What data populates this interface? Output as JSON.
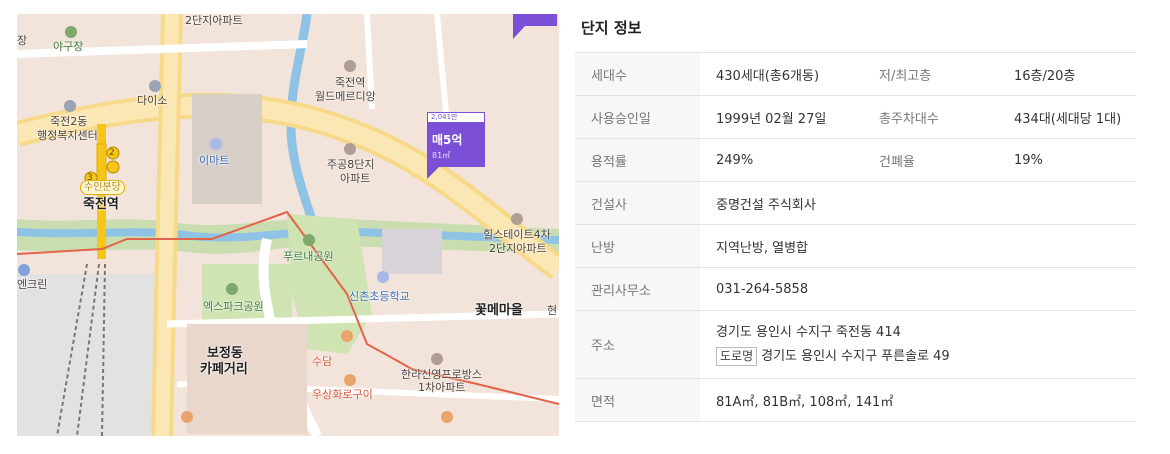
{
  "map": {
    "labels": {
      "l01": "2단지아파트",
      "l02": "장",
      "l03": "야구장",
      "l04": "다이소",
      "l05": "죽전2동",
      "l06": "행정복지센터",
      "l07": "이마트",
      "l08": "수인분당",
      "l09": "죽전역",
      "l10": "죽전역",
      "l11": "월드메르디앙",
      "l12": "주공8단지",
      "l13": "아파트",
      "l14": "힐스테이트4차",
      "l15": "2단지아파트",
      "l16": "푸르내공원",
      "l17": "신촌초등학교",
      "l18": "엑스파크공원",
      "l19": "꽃메마을",
      "l20": "보정동",
      "l21": "카페거리",
      "l22": "수담",
      "l23": "한라신영프로방스",
      "l24": "1차아파트",
      "l25": "우상화로구이",
      "l26": "엔크린",
      "l27": "현"
    },
    "station_numbers": {
      "exit2": "2",
      "exit3": "3"
    },
    "pin": {
      "price": "2,041만",
      "deal": "매5억",
      "area": "81㎡"
    },
    "colors": {
      "pin": "#7b4fd6",
      "boundary": "#e2644a",
      "subway": "#f5c518"
    }
  },
  "panel": {
    "title": "단지 정보",
    "rows": {
      "r1": {
        "k1": "세대수",
        "v1": "430세대(총6개동)",
        "k2": "저/최고층",
        "v2": "16층/20층"
      },
      "r2": {
        "k1": "사용승인일",
        "v1": "1999년 02월 27일",
        "k2": "총주차대수",
        "v2": "434대(세대당 1대)"
      },
      "r3": {
        "k1": "용적률",
        "v1": "249%",
        "k2": "건폐율",
        "v2": "19%"
      },
      "r4": {
        "k": "건설사",
        "v": "중명건설 주식회사"
      },
      "r5": {
        "k": "난방",
        "v": "지역난방, 열병합"
      },
      "r6": {
        "k": "관리사무소",
        "v": "031-264-5858"
      },
      "r7": {
        "k": "주소",
        "jibun": "경기도 용인시 수지구 죽전동 414",
        "road_badge": "도로명",
        "road": "경기도 용인시 수지구 푸른솔로 49"
      },
      "r8": {
        "k": "면적",
        "v": "81A㎡, 81B㎡, 108㎡, 141㎡"
      }
    }
  }
}
